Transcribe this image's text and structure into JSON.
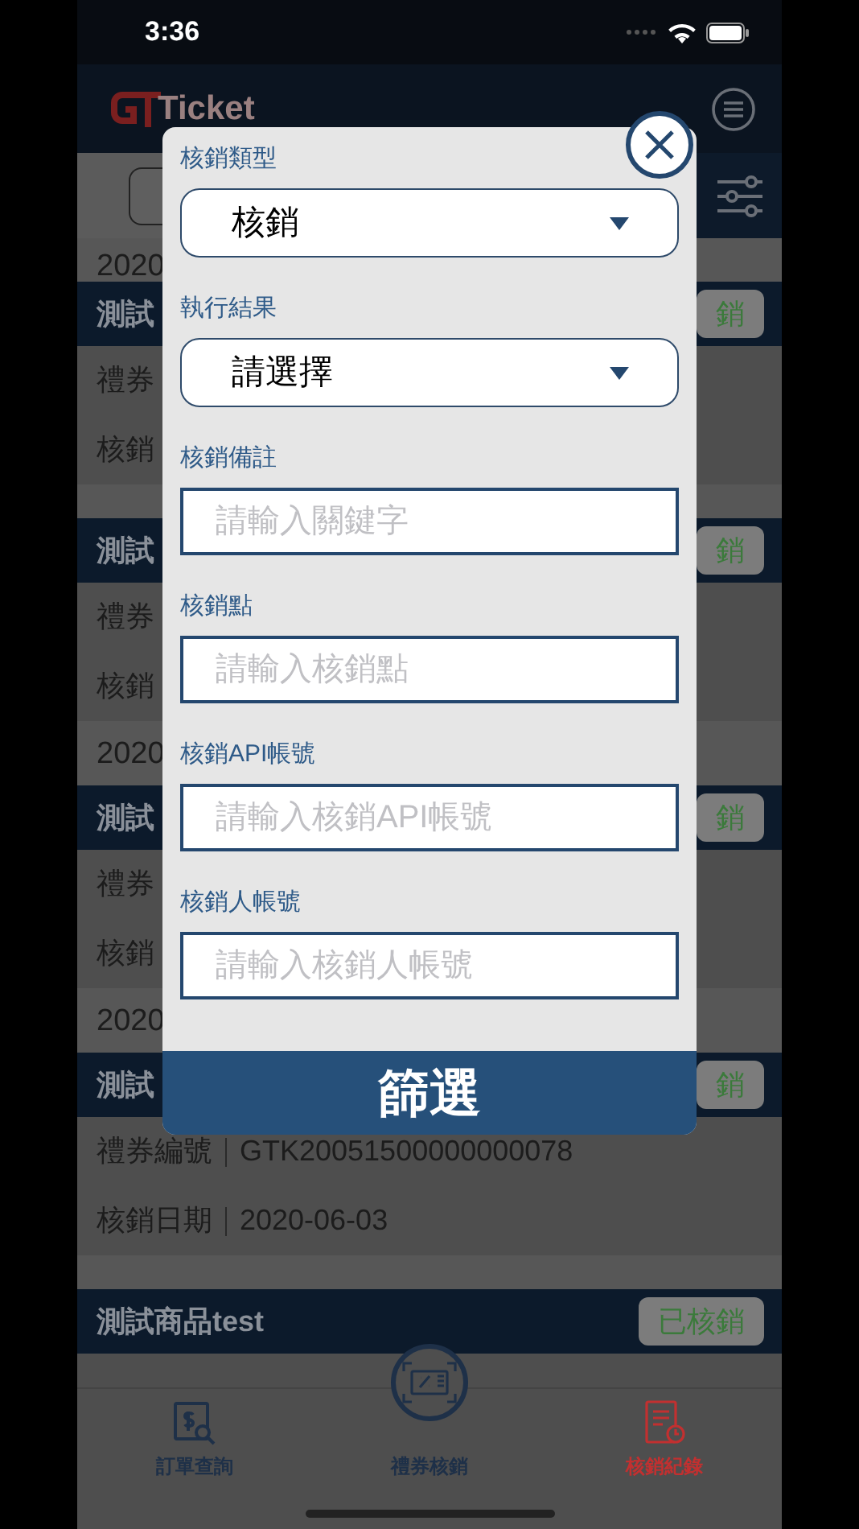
{
  "status_bar": {
    "time": "3:36"
  },
  "header": {
    "logo_text": "Ticket"
  },
  "records": [
    {
      "kind": "date",
      "text": "2020"
    },
    {
      "kind": "header",
      "title": "測試",
      "badge": "銷"
    },
    {
      "kind": "field",
      "label": "禮券"
    },
    {
      "kind": "field",
      "label": "核銷"
    },
    {
      "kind": "gap"
    },
    {
      "kind": "header",
      "title": "測試",
      "badge": "銷"
    },
    {
      "kind": "field",
      "label": "禮券"
    },
    {
      "kind": "field",
      "label": "核銷"
    },
    {
      "kind": "date",
      "text": "2020"
    },
    {
      "kind": "header",
      "title": "測試",
      "badge": "銷"
    },
    {
      "kind": "field",
      "label": "禮券"
    },
    {
      "kind": "field",
      "label": "核銷"
    },
    {
      "kind": "date",
      "text": "2020"
    },
    {
      "kind": "header",
      "title": "測試",
      "badge": "銷"
    },
    {
      "kind": "field",
      "label": "禮券編號",
      "value": "GTK20051500000000078"
    },
    {
      "kind": "field",
      "label": "核銷日期",
      "value": "2020-06-03"
    },
    {
      "kind": "gap"
    },
    {
      "kind": "header",
      "title": "測試商品test",
      "badge": "已核銷"
    }
  ],
  "filter_dialog": {
    "fields": [
      {
        "kind": "select",
        "label": "核銷類型",
        "value": "核銷"
      },
      {
        "kind": "select",
        "label": "執行結果",
        "value": "請選擇"
      },
      {
        "kind": "input",
        "label": "核銷備註",
        "placeholder": "請輸入關鍵字"
      },
      {
        "kind": "input",
        "label": "核銷點",
        "placeholder": "請輸入核銷點"
      },
      {
        "kind": "input",
        "label": "核銷API帳號",
        "placeholder": "請輸入核銷API帳號"
      },
      {
        "kind": "input",
        "label": "核銷人帳號",
        "placeholder": "請輸入核銷人帳號"
      }
    ],
    "submit_button": "篩選"
  },
  "tab_bar": [
    {
      "kind": "query",
      "label": "訂單查詢",
      "selected": false
    },
    {
      "kind": "redeem",
      "label": "禮券核銷",
      "selected": false
    },
    {
      "kind": "records",
      "label": "核銷紀錄",
      "selected": true
    }
  ]
}
